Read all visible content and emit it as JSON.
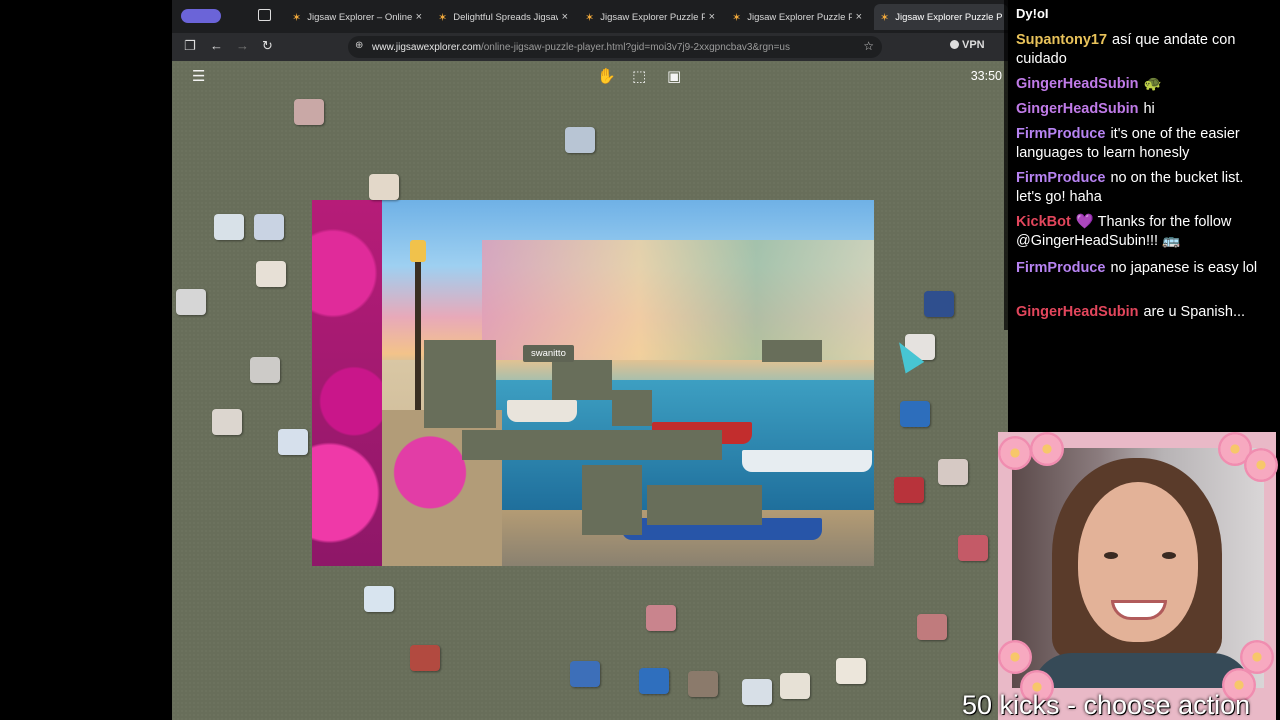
{
  "browser": {
    "tabs": [
      {
        "title": "Jigsaw Explorer – Online Ji",
        "active": false
      },
      {
        "title": "Delightful Spreads Jigsaw",
        "active": false
      },
      {
        "title": "Jigsaw Explorer Puzzle Pla",
        "active": false
      },
      {
        "title": "Jigsaw Explorer Puzzle Pla",
        "active": false
      },
      {
        "title": "Jigsaw Explorer Puzzle Pla",
        "active": true
      }
    ],
    "url_host": "www.jigsawexplorer.com",
    "url_path": "/online-jigsaw-puzzle-player.html?gid=moi3v7j9-2xxgpncbav3&rgn=us",
    "vpn_label": "VPN"
  },
  "puzzle": {
    "timer": "33:50",
    "player_label": "swanitto"
  },
  "chat": {
    "top_fragment": "Dy!oI",
    "messages": [
      {
        "user": "Supantony17",
        "color": "#e8c25a",
        "text": "así que andate con cuidado"
      },
      {
        "user": "GingerHeadSubin",
        "color": "#c07be8",
        "text": "🐢"
      },
      {
        "user": "GingerHeadSubin",
        "color": "#c07be8",
        "text": "hi"
      },
      {
        "user": "FirmProduce",
        "color": "#b783f2",
        "text": "it's one of the easier languages to learn honesly"
      },
      {
        "user": "FirmProduce",
        "color": "#b783f2",
        "text": "no on the bucket list. let's go! haha"
      },
      {
        "user": "KickBot",
        "color": "#e2465c",
        "text": "💜 Thanks for the follow @GingerHeadSubin!!! 🚌"
      },
      {
        "user": "FirmProduce",
        "color": "#b783f2",
        "text": "no japanese is easy lol"
      },
      {
        "user": "GingerHeadSubin",
        "color": "#e2465c",
        "text": "are u Spanish..."
      }
    ]
  },
  "overlay": {
    "kicks_text": "50 kicks - choose action"
  }
}
